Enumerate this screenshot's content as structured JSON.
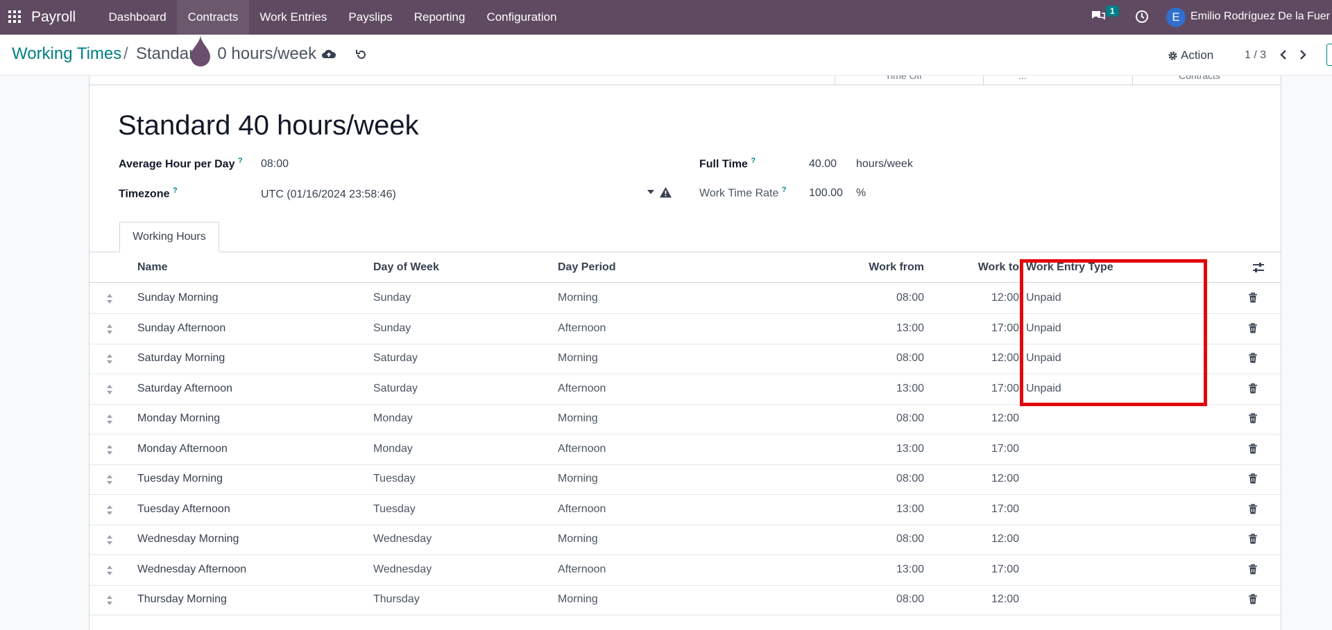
{
  "topbar": {
    "brand": "Payroll",
    "menu": [
      {
        "label": "Dashboard"
      },
      {
        "label": "Contracts"
      },
      {
        "label": "Work Entries"
      },
      {
        "label": "Payslips"
      },
      {
        "label": "Reporting"
      },
      {
        "label": "Configuration"
      }
    ],
    "chat_count": "1",
    "avatar_letter": "E",
    "user_name": "Emilio Rodríguez De la Fuer",
    "bar_color": "#5f4a61"
  },
  "control": {
    "breadcrumb_parent": "Working Times",
    "breadcrumb_sep": "/",
    "breadcrumb_current": "Standar     0 hours/week",
    "action_label": "Action",
    "pager": "1 / 3"
  },
  "smart_buttons": [
    {
      "label": "Time Off"
    },
    {
      "label": "..."
    },
    {
      "label": "Contracts"
    }
  ],
  "form": {
    "title": "Standard 40 hours/week",
    "avg_hour_label": "Average Hour per Day",
    "avg_hour_value": "08:00",
    "timezone_label": "Timezone",
    "timezone_value": "UTC (01/16/2024 23:58:46)",
    "full_time_label": "Full Time",
    "full_time_value": "40.00",
    "full_time_unit": "hours/week",
    "rate_label": "Work Time Rate",
    "rate_value": "100.00",
    "rate_unit": "%",
    "help_mark": "?"
  },
  "tabs": [
    {
      "label": "Working Hours"
    }
  ],
  "table": {
    "headers": {
      "name": "Name",
      "day_of_week": "Day of Week",
      "day_period": "Day Period",
      "work_from": "Work from",
      "work_to": "Work to",
      "work_entry_type": "Work Entry Type"
    },
    "rows": [
      {
        "name": "Sunday Morning",
        "day": "Sunday",
        "period": "Morning",
        "from": "08:00",
        "to": "12:00",
        "type": "Unpaid"
      },
      {
        "name": "Sunday Afternoon",
        "day": "Sunday",
        "period": "Afternoon",
        "from": "13:00",
        "to": "17:00",
        "type": "Unpaid"
      },
      {
        "name": "Saturday Morning",
        "day": "Saturday",
        "period": "Morning",
        "from": "08:00",
        "to": "12:00",
        "type": "Unpaid"
      },
      {
        "name": "Saturday Afternoon",
        "day": "Saturday",
        "period": "Afternoon",
        "from": "13:00",
        "to": "17:00",
        "type": "Unpaid"
      },
      {
        "name": "Monday Morning",
        "day": "Monday",
        "period": "Morning",
        "from": "08:00",
        "to": "12:00",
        "type": ""
      },
      {
        "name": "Monday Afternoon",
        "day": "Monday",
        "period": "Afternoon",
        "from": "13:00",
        "to": "17:00",
        "type": ""
      },
      {
        "name": "Tuesday Morning",
        "day": "Tuesday",
        "period": "Morning",
        "from": "08:00",
        "to": "12:00",
        "type": ""
      },
      {
        "name": "Tuesday Afternoon",
        "day": "Tuesday",
        "period": "Afternoon",
        "from": "13:00",
        "to": "17:00",
        "type": ""
      },
      {
        "name": "Wednesday Morning",
        "day": "Wednesday",
        "period": "Morning",
        "from": "08:00",
        "to": "12:00",
        "type": ""
      },
      {
        "name": "Wednesday Afternoon",
        "day": "Wednesday",
        "period": "Afternoon",
        "from": "13:00",
        "to": "17:00",
        "type": ""
      },
      {
        "name": "Thursday Morning",
        "day": "Thursday",
        "period": "Morning",
        "from": "08:00",
        "to": "12:00",
        "type": ""
      }
    ]
  },
  "colors": {
    "accent": "#017e84",
    "highlight": "#e3070a"
  }
}
